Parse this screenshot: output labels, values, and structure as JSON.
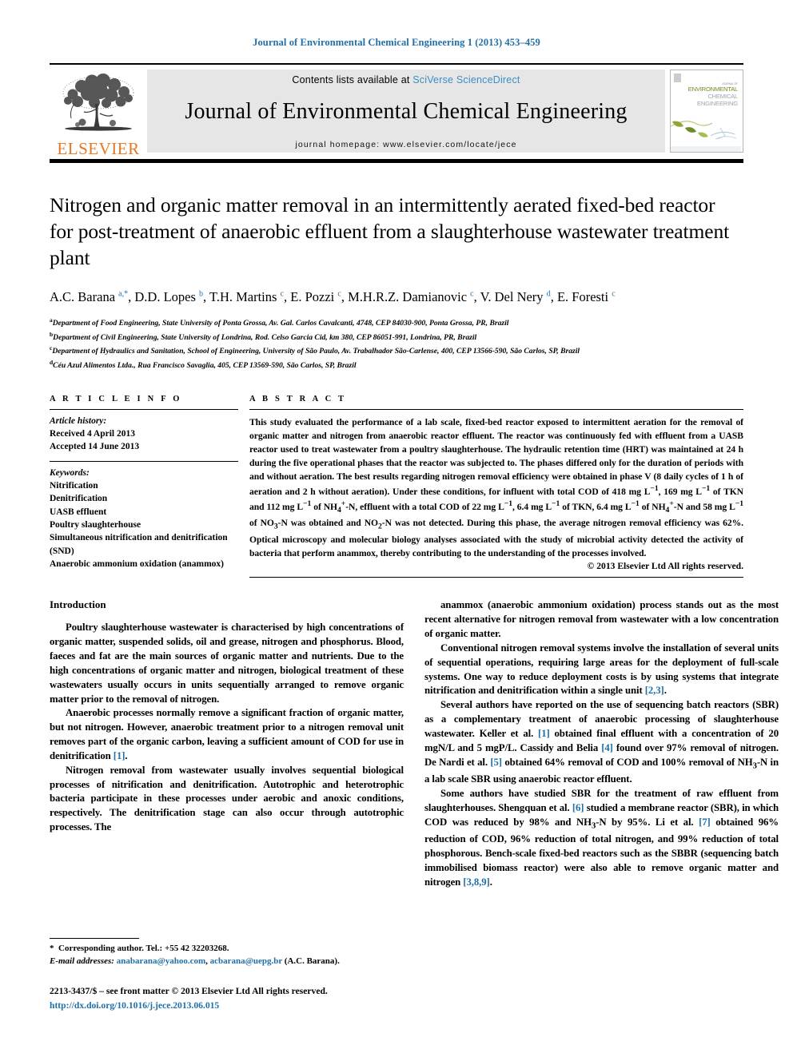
{
  "running_head": "Journal of Environmental Chemical Engineering 1 (2013) 453–459",
  "masthead": {
    "publisher_wordmark": "ELSEVIER",
    "contents_prefix": "Contents lists available at ",
    "contents_link": "SciVerse ScienceDirect",
    "journal_name": "Journal of Environmental Chemical Engineering",
    "homepage": "journal homepage: www.elsevier.com/locate/jece",
    "cover": {
      "line1": "ENVIRONMENTAL",
      "line2": "CHEMICAL",
      "line3": "ENGINEERING",
      "kicker": "JOURNAL OF"
    }
  },
  "article": {
    "title": "Nitrogen and organic matter removal in an intermittently aerated fixed-bed reactor for post-treatment of anaerobic effluent from a slaughterhouse wastewater treatment plant",
    "authors_html": "A.C. Barana <sup>a,*</sup>, D.D. Lopes <sup>b</sup>, T.H. Martins <sup>c</sup>, E. Pozzi <sup>c</sup>, M.H.R.Z. Damianovic <sup>c</sup>, V. Del Nery <sup>d</sup>, E. Foresti <sup>c</sup>",
    "affiliations": [
      {
        "marker": "a",
        "text": "Department of Food Engineering, State University of Ponta Grossa, Av. Gal. Carlos Cavalcanti, 4748, CEP 84030-900, Ponta Grossa, PR, Brazil"
      },
      {
        "marker": "b",
        "text": "Department of Civil Engineering, State University of Londrina, Rod. Celso Garcia Cid, km 380, CEP 86051-991, Londrina, PR, Brazil"
      },
      {
        "marker": "c",
        "text": "Department of Hydraulics and Sanitation, School of Engineering, University of São Paulo, Av. Trabalhador São-Carlense, 400, CEP 13566-590, São Carlos, SP, Brazil"
      },
      {
        "marker": "d",
        "text": "Céu Azul Alimentos Ltda., Rua Francisco Savaglia, 405, CEP 13569-590, São Carlos, SP, Brazil"
      }
    ]
  },
  "article_info": {
    "heading": "A R T I C L E  I N F O",
    "history_label": "Article history:",
    "received": "Received 4 April 2013",
    "accepted": "Accepted 14 June 2013",
    "keywords_label": "Keywords:",
    "keywords": [
      "Nitrification",
      "Denitrification",
      "UASB effluent",
      "Poultry slaughterhouse",
      "Simultaneous nitrification and denitrification (SND)",
      "Anaerobic ammonium oxidation (anammox)"
    ]
  },
  "abstract": {
    "heading": "A B S T R A C T",
    "text_html": "This study evaluated the performance of a lab scale, fixed-bed reactor exposed to intermittent aeration for the removal of organic matter and nitrogen from anaerobic reactor effluent. The reactor was continuously fed with effluent from a UASB reactor used to treat wastewater from a poultry slaughterhouse. The hydraulic retention time (HRT) was maintained at 24 h during the five operational phases that the reactor was subjected to. The phases differed only for the duration of periods with and without aeration. The best results regarding nitrogen removal efficiency were obtained in phase V (8 daily cycles of 1 h of aeration and 2 h without aeration). Under these conditions, for influent with total COD of 418 mg L<sup>−1</sup>, 169 mg L<sup>−1</sup> of TKN and 112 mg L<sup>−1</sup> of NH<sub>4</sub><sup>+</sup>-N, effluent with a total COD of 22 mg L<sup>−1</sup>, 6.4 mg L<sup>−1</sup> of TKN, 6.4 mg L<sup>−1</sup> of NH<sub>4</sub><sup>+</sup>-N and 58 mg L<sup>−1</sup> of NO<sub>3</sub>-N was obtained and NO<sub>2</sub>-N was not detected. During this phase, the average nitrogen removal efficiency was 62%. Optical microscopy and molecular biology analyses associated with the study of microbial activity detected the activity of bacteria that perform anammox, thereby contributing to the understanding of the processes involved.",
    "copyright": "© 2013 Elsevier Ltd All rights reserved."
  },
  "introduction": {
    "heading": "Introduction",
    "left_paragraphs_html": [
      "Poultry slaughterhouse wastewater is characterised by high concentrations of organic matter, suspended solids, oil and grease, nitrogen and phosphorus. Blood, faeces and fat are the main sources of organic matter and nutrients. Due to the high concentrations of organic matter and nitrogen, biological treatment of these wastewaters usually occurs in units sequentially arranged to remove organic matter prior to the removal of nitrogen.",
      "Anaerobic processes normally remove a significant fraction of organic matter, but not nitrogen. However, anaerobic treatment prior to a nitrogen removal unit removes part of the organic carbon, leaving a sufficient amount of COD for use in denitrification <span class=\"ref\">[1]</span>.",
      "Nitrogen removal from wastewater usually involves sequential biological processes of nitrification and denitrification. Autotrophic and heterotrophic bacteria participate in these processes under aerobic and anoxic conditions, respectively. The denitrification stage can also occur through autotrophic processes. The"
    ],
    "right_paragraphs_html": [
      "anammox (anaerobic ammonium oxidation) process stands out as the most recent alternative for nitrogen removal from wastewater with a low concentration of organic matter.",
      "Conventional nitrogen removal systems involve the installation of several units of sequential operations, requiring large areas for the deployment of full-scale systems. One way to reduce deployment costs is by using systems that integrate nitrification and denitrification within a single unit <span class=\"ref\">[2,3]</span>.",
      "Several authors have reported on the use of sequencing batch reactors (SBR) as a complementary treatment of anaerobic processing of slaughterhouse wastewater. Keller et al. <span class=\"ref\">[1]</span> obtained final effluent with a concentration of 20 mgN/L and 5 mgP/L. Cassidy and Belia <span class=\"ref\">[4]</span> found over 97% removal of nitrogen. De Nardi et al. <span class=\"ref\">[5]</span> obtained 64% removal of COD and 100% removal of NH<sub>3</sub>-N in a lab scale SBR using anaerobic reactor effluent.",
      "Some authors have studied SBR for the treatment of raw effluent from slaughterhouses. Shengquan et al. <span class=\"ref\">[6]</span> studied a membrane reactor (SBR), in which COD was reduced by 98% and NH<sub>3</sub>-N by 95%. Li et al. <span class=\"ref\">[7]</span> obtained 96% reduction of COD, 96% reduction of total nitrogen, and 99% reduction of total phosphorous. Bench-scale fixed-bed reactors such as the SBBR (sequencing batch immobilised biomass reactor) were also able to remove organic matter and nitrogen <span class=\"ref\">[3,8,9]</span>."
    ]
  },
  "footer": {
    "corresponding_html": "<span class=\"star\">*</span>&nbsp; Corresponding author. Tel.: +55 42 32203268.",
    "email_label": "E-mail addresses:",
    "email_1": "anabarana@yahoo.com",
    "email_2": "acbarana@uepg.br",
    "email_owner": "(A.C. Barana).",
    "issn_line": "2213-3437/$ – see front matter © 2013 Elsevier Ltd All rights reserved.",
    "doi": "http://dx.doi.org/10.1016/j.jece.2013.06.015"
  },
  "colors": {
    "link_blue": "#1f6fa8",
    "sciencedirect_blue": "#3b8fc4",
    "elsevier_orange": "#E87722",
    "band_grey": "#e6e6e6"
  }
}
